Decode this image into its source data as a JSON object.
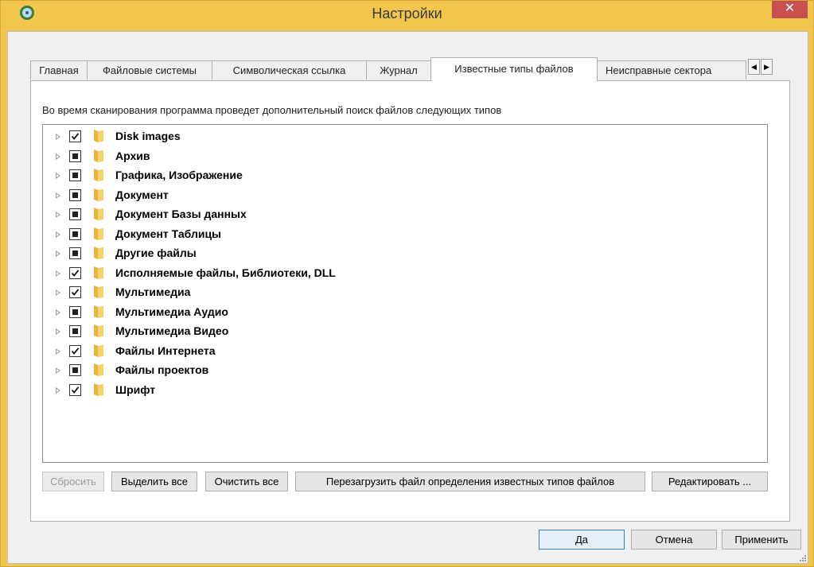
{
  "window": {
    "title": "Настройки",
    "close_label": "✕"
  },
  "tabs": [
    {
      "label": "Главная",
      "active": false
    },
    {
      "label": "Файловые системы",
      "active": false
    },
    {
      "label": "Символическая ссылка",
      "active": false
    },
    {
      "label": "Журнал",
      "active": false
    },
    {
      "label": "Известные типы файлов",
      "active": true
    },
    {
      "label": "Неисправные сектора",
      "active": false
    }
  ],
  "panel": {
    "description": "Во время сканирования программа проведет дополнительный поиск файлов следующих типов"
  },
  "file_types": [
    {
      "label": "Disk images",
      "state": "checked"
    },
    {
      "label": "Архив",
      "state": "partial"
    },
    {
      "label": "Графика, Изображение",
      "state": "partial"
    },
    {
      "label": "Документ",
      "state": "partial"
    },
    {
      "label": "Документ Базы данных",
      "state": "partial"
    },
    {
      "label": "Документ Таблицы",
      "state": "partial"
    },
    {
      "label": "Другие файлы",
      "state": "partial"
    },
    {
      "label": "Исполняемые файлы, Библиотеки, DLL",
      "state": "checked"
    },
    {
      "label": "Мультимедиа",
      "state": "checked"
    },
    {
      "label": "Мультимедиа Аудио",
      "state": "partial"
    },
    {
      "label": "Мультимедиа Видео",
      "state": "partial"
    },
    {
      "label": "Файлы Интернета",
      "state": "checked"
    },
    {
      "label": "Файлы проектов",
      "state": "partial"
    },
    {
      "label": "Шрифт",
      "state": "checked"
    }
  ],
  "panel_buttons": {
    "reset": "Сбросить",
    "select_all": "Выделить все",
    "clear_all": "Очистить все",
    "reload": "Перезагрузить файл определения известных типов файлов",
    "edit": "Редактировать ..."
  },
  "dialog_buttons": {
    "ok": "Да",
    "cancel": "Отмена",
    "apply": "Применить"
  },
  "colors": {
    "titlebar": "#f1c64c",
    "close": "#c75050",
    "folder": "#f5d36b"
  }
}
